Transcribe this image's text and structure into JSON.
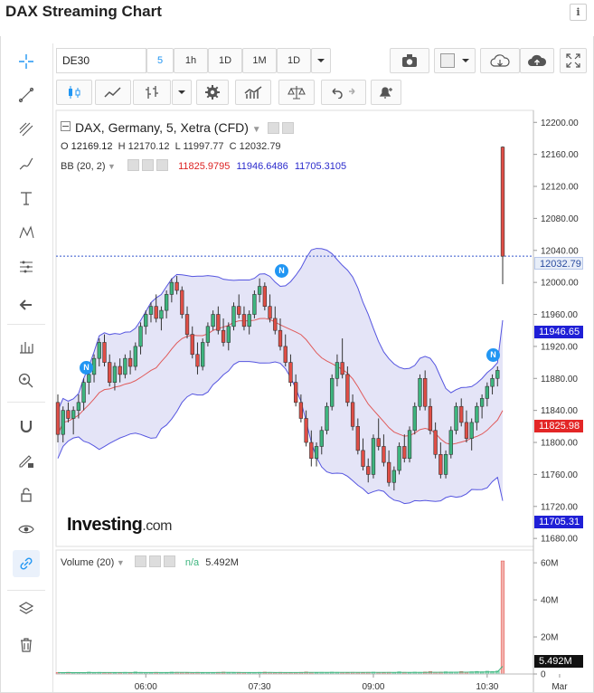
{
  "page": {
    "title": "DAX Streaming Chart",
    "info_label": "i"
  },
  "toolbar": {
    "symbol": "DE30",
    "intervals": [
      "5",
      "1h",
      "1D",
      "1M",
      "1D"
    ],
    "active_interval": "5"
  },
  "legend": {
    "instrument": "DAX, Germany, 5, Xetra (CFD)",
    "ohlc": {
      "o_label": "O",
      "o": "12169.12",
      "h_label": "H",
      "h": "12170.12",
      "l_label": "L",
      "l": "11997.77",
      "c_label": "C",
      "c": "12032.79"
    },
    "bb_label": "BB (20, 2)",
    "bb_upper": "11825.9795",
    "bb_mid": "11946.6486",
    "bb_lower": "11705.3105",
    "volume_label": "Volume (20)",
    "volume_na": "n/a",
    "volume_value": "5.492M"
  },
  "watermark": {
    "brand": "Investing",
    "suffix": ".com"
  },
  "price_tags": {
    "last": "12032.79",
    "upper": "11946.65",
    "mid": "11825.98",
    "lower": "11705.31",
    "volume": "5.492M"
  },
  "colors": {
    "up": "#3eb57f",
    "down": "#e04e46",
    "band_fill": "#e4e4f7",
    "band_line": "#5555e0",
    "mid_line": "#e05a5a",
    "last_line": "#3355cc",
    "accent": "#2196f3"
  },
  "icons": [
    "crosshair-icon",
    "trendline-icon",
    "fib-icon",
    "brush-icon",
    "text-icon",
    "pattern-icon",
    "measure-icon",
    "back-arrow-icon",
    "ruler-icon",
    "zoom-in-icon",
    "magnet-icon",
    "lock-pencil-icon",
    "unlock-icon",
    "eye-icon",
    "link-icon",
    "layers-icon",
    "trash-icon"
  ],
  "chart_data": {
    "type": "candlestick",
    "title": "DAX, Germany, 5, Xetra (CFD)",
    "y_ticks": [
      "12200.00",
      "12160.00",
      "12120.00",
      "12080.00",
      "12040.00",
      "12000.00",
      "11960.00",
      "11920.00",
      "11880.00",
      "11840.00",
      "11800.00",
      "11760.00",
      "11720.00",
      "11680.00"
    ],
    "ylim": [
      11670,
      12215
    ],
    "x_ticks": [
      "06:00",
      "07:30",
      "09:00",
      "10:30",
      "Mar"
    ],
    "x_tick_bar_index": [
      17,
      39,
      61,
      83,
      97
    ],
    "volume_ticks": [
      "60M",
      "40M",
      "20M",
      "0"
    ],
    "volume_ylim": [
      0,
      62
    ],
    "last_price": 12032.79,
    "candles": [
      [
        11850,
        11860,
        11800,
        11810
      ],
      [
        11810,
        11845,
        11800,
        11840
      ],
      [
        11840,
        11850,
        11825,
        11830
      ],
      [
        11830,
        11845,
        11810,
        11840
      ],
      [
        11840,
        11860,
        11830,
        11850
      ],
      [
        11850,
        11880,
        11840,
        11875
      ],
      [
        11875,
        11890,
        11860,
        11885
      ],
      [
        11885,
        11910,
        11875,
        11905
      ],
      [
        11905,
        11930,
        11895,
        11925
      ],
      [
        11925,
        11935,
        11895,
        11900
      ],
      [
        11900,
        11910,
        11870,
        11875
      ],
      [
        11875,
        11900,
        11865,
        11895
      ],
      [
        11895,
        11905,
        11875,
        11885
      ],
      [
        11885,
        11910,
        11880,
        11905
      ],
      [
        11905,
        11915,
        11885,
        11895
      ],
      [
        11895,
        11925,
        11890,
        11920
      ],
      [
        11920,
        11950,
        11910,
        11945
      ],
      [
        11945,
        11965,
        11935,
        11960
      ],
      [
        11960,
        11975,
        11950,
        11970
      ],
      [
        11970,
        11985,
        11950,
        11955
      ],
      [
        11955,
        11970,
        11940,
        11965
      ],
      [
        11965,
        11990,
        11955,
        11985
      ],
      [
        11985,
        12005,
        11975,
        12000
      ],
      [
        12000,
        12008,
        11985,
        11990
      ],
      [
        11990,
        11995,
        11955,
        11960
      ],
      [
        11960,
        11970,
        11930,
        11935
      ],
      [
        11935,
        11945,
        11905,
        11910
      ],
      [
        11910,
        11925,
        11885,
        11895
      ],
      [
        11895,
        11930,
        11890,
        11925
      ],
      [
        11925,
        11950,
        11920,
        11945
      ],
      [
        11945,
        11965,
        11940,
        11960
      ],
      [
        11960,
        11970,
        11935,
        11940
      ],
      [
        11940,
        11955,
        11920,
        11925
      ],
      [
        11925,
        11950,
        11915,
        11945
      ],
      [
        11945,
        11975,
        11940,
        11970
      ],
      [
        11970,
        11985,
        11955,
        11960
      ],
      [
        11960,
        11970,
        11940,
        11945
      ],
      [
        11945,
        11965,
        11935,
        11960
      ],
      [
        11960,
        11990,
        11955,
        11985
      ],
      [
        11985,
        12005,
        11975,
        11995
      ],
      [
        11995,
        12000,
        11965,
        11970
      ],
      [
        11970,
        11985,
        11950,
        11955
      ],
      [
        11955,
        11970,
        11935,
        11940
      ],
      [
        11940,
        11955,
        11915,
        11920
      ],
      [
        11920,
        11935,
        11895,
        11900
      ],
      [
        11900,
        11910,
        11870,
        11875
      ],
      [
        11875,
        11885,
        11845,
        11850
      ],
      [
        11850,
        11860,
        11825,
        11830
      ],
      [
        11830,
        11840,
        11795,
        11800
      ],
      [
        11800,
        11815,
        11770,
        11780
      ],
      [
        11780,
        11800,
        11770,
        11795
      ],
      [
        11795,
        11820,
        11785,
        11815
      ],
      [
        11815,
        11850,
        11810,
        11845
      ],
      [
        11845,
        11885,
        11840,
        11880
      ],
      [
        11880,
        11910,
        11870,
        11900
      ],
      [
        11900,
        11930,
        11880,
        11885
      ],
      [
        11885,
        11895,
        11845,
        11850
      ],
      [
        11850,
        11860,
        11815,
        11820
      ],
      [
        11820,
        11830,
        11785,
        11790
      ],
      [
        11790,
        11805,
        11765,
        11770
      ],
      [
        11770,
        11780,
        11750,
        11760
      ],
      [
        11760,
        11810,
        11755,
        11805
      ],
      [
        11805,
        11830,
        11790,
        11795
      ],
      [
        11795,
        11810,
        11770,
        11775
      ],
      [
        11775,
        11790,
        11745,
        11750
      ],
      [
        11750,
        11770,
        11740,
        11765
      ],
      [
        11765,
        11800,
        11760,
        11795
      ],
      [
        11795,
        11810,
        11775,
        11780
      ],
      [
        11780,
        11820,
        11775,
        11815
      ],
      [
        11815,
        11850,
        11810,
        11845
      ],
      [
        11845,
        11885,
        11840,
        11880
      ],
      [
        11880,
        11890,
        11840,
        11845
      ],
      [
        11845,
        11855,
        11810,
        11815
      ],
      [
        11815,
        11825,
        11780,
        11785
      ],
      [
        11785,
        11800,
        11755,
        11760
      ],
      [
        11760,
        11790,
        11755,
        11785
      ],
      [
        11785,
        11820,
        11780,
        11815
      ],
      [
        11815,
        11850,
        11810,
        11845
      ],
      [
        11845,
        11855,
        11820,
        11825
      ],
      [
        11825,
        11840,
        11800,
        11805
      ],
      [
        11805,
        11830,
        11790,
        11825
      ],
      [
        11825,
        11850,
        11815,
        11845
      ],
      [
        11845,
        11860,
        11830,
        11855
      ],
      [
        11855,
        11875,
        11845,
        11870
      ],
      [
        11870,
        11885,
        11860,
        11880
      ],
      [
        11880,
        11895,
        11870,
        11890
      ],
      [
        12169.12,
        12170.12,
        11997.77,
        12032.79
      ]
    ],
    "volume": [
      0.8,
      0.7,
      0.9,
      0.6,
      0.8,
      0.7,
      1.0,
      0.8,
      0.9,
      0.7,
      0.8,
      0.6,
      0.7,
      0.9,
      0.8,
      1.1,
      0.9,
      0.8,
      0.7,
      0.9,
      0.8,
      0.7,
      1.0,
      0.9,
      0.8,
      0.7,
      0.8,
      0.9,
      0.6,
      0.8,
      0.7,
      0.9,
      1.0,
      0.8,
      0.7,
      0.9,
      0.8,
      0.7,
      0.8,
      0.9,
      1.0,
      0.8,
      0.7,
      0.9,
      0.8,
      0.7,
      0.8,
      0.9,
      1.1,
      0.8,
      0.7,
      0.9,
      0.8,
      1.0,
      0.9,
      0.8,
      0.7,
      0.9,
      0.8,
      0.7,
      0.9,
      1.0,
      0.8,
      0.7,
      0.9,
      0.8,
      1.2,
      0.9,
      0.8,
      1.0,
      0.9,
      1.1,
      1.3,
      0.9,
      1.0,
      1.2,
      1.1,
      1.0,
      1.3,
      1.1,
      1.2,
      1.4,
      1.2,
      1.5,
      1.3,
      1.6,
      61.0
    ]
  }
}
